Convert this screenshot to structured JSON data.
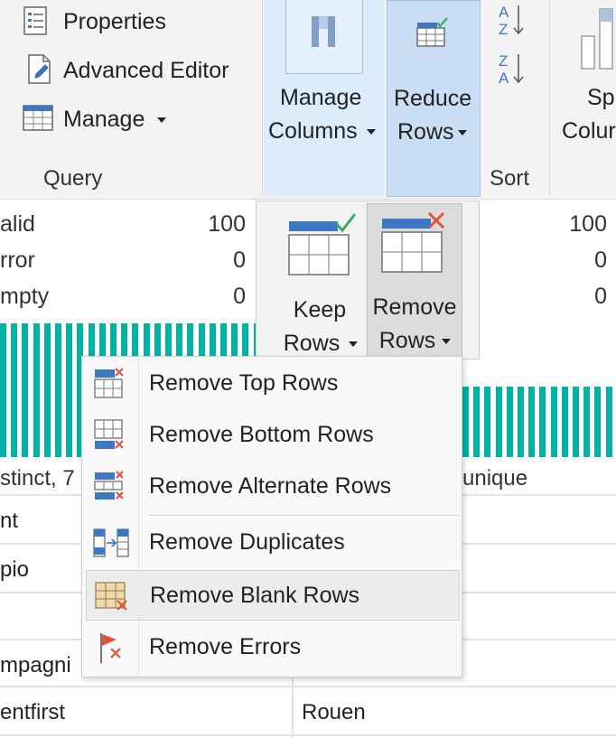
{
  "ribbon": {
    "query_group": {
      "properties_label": "Properties",
      "advanced_editor_label": "Advanced Editor",
      "manage_label": "Manage",
      "group_label": "Query"
    },
    "manage_columns": {
      "line1": "Manage",
      "line2": "Columns"
    },
    "reduce_rows": {
      "line1": "Reduce",
      "line2": "Rows"
    },
    "sort": {
      "group_label": "Sort"
    },
    "split_column": {
      "line1": "Sp",
      "line2": "Colur"
    }
  },
  "reduce_rows_gallery": {
    "keep_rows": {
      "line1": "Keep",
      "line2": "Rows"
    },
    "remove_rows": {
      "line1": "Remove",
      "line2": "Rows"
    }
  },
  "remove_rows_menu": {
    "items": [
      {
        "label": "Remove Top Rows",
        "icon": "remove-top-rows-icon"
      },
      {
        "label": "Remove Bottom Rows",
        "icon": "remove-bottom-rows-icon"
      },
      {
        "label": "Remove Alternate Rows",
        "icon": "remove-alternate-rows-icon"
      },
      {
        "label": "Remove Duplicates",
        "icon": "remove-duplicates-icon"
      },
      {
        "label": "Remove Blank Rows",
        "icon": "remove-blank-rows-icon",
        "highlighted": true
      },
      {
        "label": "Remove Errors",
        "icon": "remove-errors-icon"
      }
    ]
  },
  "column_quality": {
    "left": {
      "valid_label": "alid",
      "error_label": "rror",
      "empty_label": "mpty",
      "valid_value": "100",
      "error_value": "0",
      "empty_value": "0"
    },
    "right": {
      "valid_value": "100",
      "error_value": "0",
      "empty_value": "0"
    }
  },
  "distribution": {
    "left_caption": "stinct, 7",
    "right_caption": "unique",
    "bar_color": "#00b3a4"
  },
  "table": {
    "rows": [
      {
        "left": "nt",
        "right": ""
      },
      {
        "left": "pio",
        "right": ""
      },
      {
        "left": "",
        "right": ""
      },
      {
        "left": "mpagni",
        "right": ""
      },
      {
        "left": "entfirst",
        "right": "Rouen"
      }
    ]
  },
  "colors": {
    "accent_blue": "#3c78c3",
    "check_green": "#3aaa6a",
    "remove_red": "#e0533a",
    "teal": "#00b3a4"
  }
}
